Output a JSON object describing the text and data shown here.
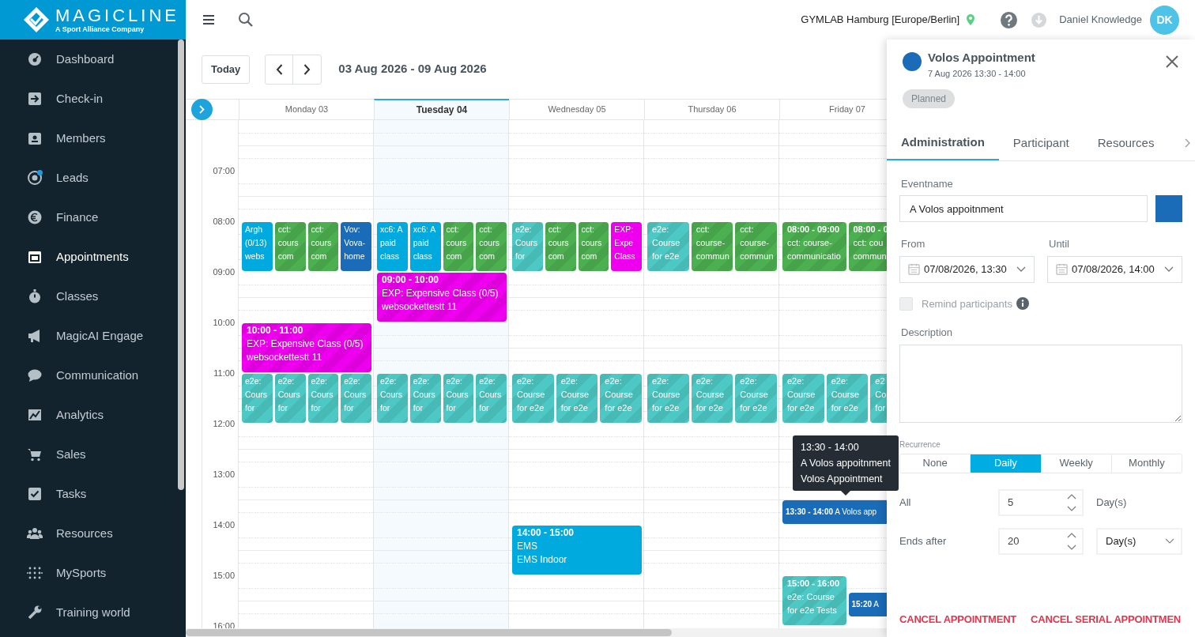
{
  "brand": {
    "name": "MAGICLINE",
    "tagline": "A Sport Alliance Company"
  },
  "sidebar": {
    "items": [
      {
        "label": "Dashboard",
        "selected": false,
        "notification": false
      },
      {
        "label": "Check-in",
        "selected": false,
        "notification": false
      },
      {
        "label": "Members",
        "selected": false,
        "notification": false
      },
      {
        "label": "Leads",
        "selected": false,
        "notification": true
      },
      {
        "label": "Finance",
        "selected": false,
        "notification": false
      },
      {
        "label": "Appointments",
        "selected": true,
        "notification": false
      },
      {
        "label": "Classes",
        "selected": false,
        "notification": false
      },
      {
        "label": "MagicAI Engage",
        "selected": false,
        "notification": false
      },
      {
        "label": "Communication",
        "selected": false,
        "notification": false
      },
      {
        "label": "Analytics",
        "selected": false,
        "notification": false
      },
      {
        "label": "Sales",
        "selected": false,
        "notification": false
      },
      {
        "label": "Tasks",
        "selected": false,
        "notification": false
      },
      {
        "label": "Resources",
        "selected": false,
        "notification": false
      },
      {
        "label": "MySports",
        "selected": false,
        "notification": false
      },
      {
        "label": "Training world",
        "selected": false,
        "notification": false
      }
    ]
  },
  "topbar": {
    "location": "GYMLAB Hamburg [Europe/Berlin]",
    "user": "Daniel Knowledge",
    "initials": "DK"
  },
  "toolbar": {
    "today": "Today",
    "range": "03 Aug 2026 - 09 Aug 2026"
  },
  "calendar": {
    "hours": [
      "07:00",
      "08:00",
      "09:00",
      "10:00",
      "11:00",
      "12:00",
      "13:00",
      "14:00",
      "15:00",
      "16:00"
    ],
    "days": [
      {
        "label": "Monday 03",
        "today": false,
        "events": [
          {
            "kind": "appointment",
            "color": "#00aadf",
            "lines": [
              "Argh",
              "(0/13)",
              "webs"
            ]
          },
          {
            "kind": "class",
            "color": "#4caf50",
            "lines": [
              "cct:",
              "cours",
              "com"
            ]
          },
          {
            "kind": "class",
            "color": "#4caf50",
            "lines": [
              "cct:",
              "cours",
              "com"
            ]
          },
          {
            "kind": "appointment",
            "color": "#1a6bb8",
            "lines": [
              "Vov:",
              "Vova-",
              "home"
            ]
          },
          {
            "kind": "class",
            "color": "#ee00ee",
            "time": "10:00 - 11:00",
            "lines": [
              "EXP: Expensive Class (0/5)",
              "websockettestt 11"
            ]
          },
          {
            "kind": "class",
            "color": "#4dc8c4",
            "lines": [
              "e2e:",
              "Cours",
              "for"
            ]
          },
          {
            "kind": "class",
            "color": "#4dc8c4",
            "lines": [
              "e2e:",
              "Cours",
              "for"
            ]
          },
          {
            "kind": "class",
            "color": "#4dc8c4",
            "lines": [
              "e2e:",
              "Cours",
              "for"
            ]
          },
          {
            "kind": "class",
            "color": "#4dc8c4",
            "lines": [
              "e2e:",
              "Cours",
              "for"
            ]
          }
        ]
      },
      {
        "label": "Tuesday 04",
        "today": true,
        "events": [
          {
            "kind": "appointment",
            "color": "#00aadf",
            "lines": [
              "xc6: A",
              "paid",
              "class"
            ]
          },
          {
            "kind": "appointment",
            "color": "#00aadf",
            "lines": [
              "xc6: A",
              "paid",
              "class"
            ]
          },
          {
            "kind": "class",
            "color": "#4caf50",
            "lines": [
              "cct:",
              "cours",
              "com"
            ]
          },
          {
            "kind": "class",
            "color": "#4caf50",
            "lines": [
              "cct:",
              "cours",
              "com"
            ]
          },
          {
            "kind": "class",
            "color": "#ee00ee",
            "time": "09:00 - 10:00",
            "lines": [
              "EXP: Expensive Class (0/5)",
              "websockettestt 11"
            ]
          },
          {
            "kind": "class",
            "color": "#4dc8c4",
            "lines": [
              "e2e:",
              "Cours",
              "for"
            ]
          },
          {
            "kind": "class",
            "color": "#4dc8c4",
            "lines": [
              "e2e:",
              "Cours",
              "for"
            ]
          },
          {
            "kind": "class",
            "color": "#4dc8c4",
            "lines": [
              "e2e:",
              "Cours",
              "for"
            ]
          },
          {
            "kind": "class",
            "color": "#4dc8c4",
            "lines": [
              "e2e:",
              "Cours",
              "for"
            ]
          }
        ]
      },
      {
        "label": "Wednesday 05",
        "today": false,
        "events": [
          {
            "kind": "class",
            "color": "#4dc8c4",
            "lines": [
              "e2e:",
              "Cours",
              "for"
            ]
          },
          {
            "kind": "class",
            "color": "#4caf50",
            "lines": [
              "cct:",
              "cours",
              "com"
            ]
          },
          {
            "kind": "class",
            "color": "#4caf50",
            "lines": [
              "cct:",
              "cours",
              "com"
            ]
          },
          {
            "kind": "appointment",
            "color": "#ee00ee",
            "lines": [
              "EXP:",
              "Expe",
              "Class"
            ]
          },
          {
            "kind": "class",
            "color": "#4dc8c4",
            "lines": [
              "e2e:",
              "Course",
              "for e2e"
            ]
          },
          {
            "kind": "class",
            "color": "#4dc8c4",
            "lines": [
              "e2e:",
              "Course",
              "for e2e"
            ]
          },
          {
            "kind": "class",
            "color": "#4dc8c4",
            "lines": [
              "e2e:",
              "Course",
              "for e2e"
            ]
          },
          {
            "kind": "appointment",
            "color": "#00aadf",
            "time": "14:00 - 15:00",
            "lines": [
              "EMS",
              "EMS Indoor"
            ]
          }
        ]
      },
      {
        "label": "Thursday 06",
        "today": false,
        "events": [
          {
            "kind": "class",
            "color": "#4dc8c4",
            "lines": [
              "e2e:",
              "Course",
              "for e2e"
            ]
          },
          {
            "kind": "class",
            "color": "#4caf50",
            "lines": [
              "cct:",
              "course-",
              "commun"
            ]
          },
          {
            "kind": "class",
            "color": "#4caf50",
            "lines": [
              "cct:",
              "course-",
              "commun"
            ]
          },
          {
            "kind": "class",
            "color": "#4dc8c4",
            "lines": [
              "e2e:",
              "Course",
              "for e2e"
            ]
          },
          {
            "kind": "class",
            "color": "#4dc8c4",
            "lines": [
              "e2e:",
              "Course",
              "for e2e"
            ]
          },
          {
            "kind": "class",
            "color": "#4dc8c4",
            "lines": [
              "e2e:",
              "Course",
              "for e2e"
            ]
          }
        ]
      },
      {
        "label": "Friday 07",
        "today": false,
        "events": [
          {
            "kind": "class",
            "color": "#4caf50",
            "time": "08:00 - 09:00",
            "lines": [
              "cct: course-",
              "communicatio"
            ]
          },
          {
            "kind": "class",
            "color": "#4caf50",
            "time": "08:00 - 0",
            "lines": [
              "cct: cou",
              "commun"
            ]
          },
          {
            "kind": "class",
            "color": "#4dc8c4",
            "lines": [
              "e2e:",
              "Course",
              "for e2e"
            ]
          },
          {
            "kind": "class",
            "color": "#4dc8c4",
            "lines": [
              "e2e:",
              "Course",
              "for e2e"
            ]
          },
          {
            "kind": "class",
            "color": "#4dc8c4",
            "lines": [
              "e2",
              "Co",
              "for"
            ]
          },
          {
            "kind": "appointment",
            "color": "#1a6bb8",
            "time": "13:30 - 14:00",
            "lines": [
              "A Volos app"
            ]
          },
          {
            "kind": "class",
            "color": "#4dc8c4",
            "time": "15:00 - 16:00",
            "lines": [
              "e2e: Course",
              "for e2e Tests"
            ]
          },
          {
            "kind": "appointment",
            "color": "#1a6bb8",
            "time": "15:20",
            "lines": [
              "A"
            ]
          }
        ]
      }
    ]
  },
  "tooltip": {
    "lines": [
      "13:30 - 14:00",
      "A Volos appoitnment",
      "Volos Appointment"
    ]
  },
  "panel": {
    "color": "#1a6bb8",
    "title": "Volos Appointment",
    "subtitle": "7 Aug 2026 13:30 - 14:00",
    "status": "Planned",
    "tabs": [
      {
        "label": "Administration",
        "selected": true
      },
      {
        "label": "Participant",
        "selected": false
      },
      {
        "label": "Resources",
        "selected": false
      }
    ],
    "eventname": {
      "label": "Eventname",
      "value": "A Volos appoitnment",
      "color": "#1a6bb8"
    },
    "from": {
      "label": "From",
      "value": "07/08/2026, 13:30"
    },
    "until": {
      "label": "Until",
      "value": "07/08/2026, 14:00"
    },
    "remind": {
      "label": "Remind participants",
      "checked": false,
      "disabled": true
    },
    "description": {
      "label": "Description"
    },
    "recurrence": {
      "label": "Recurrence",
      "options": [
        {
          "label": "None",
          "selected": false
        },
        {
          "label": "Daily",
          "selected": true
        },
        {
          "label": "Weekly",
          "selected": false
        },
        {
          "label": "Monthly",
          "selected": false
        }
      ]
    },
    "interval": {
      "label": "All",
      "value": "5",
      "unit": "Day(s)"
    },
    "ends_after": {
      "label": "Ends after",
      "value": "20",
      "unit": "Day(s)"
    },
    "actions": [
      "CANCEL APPOINTMENT",
      "CANCEL SERIAL APPOINTMEN"
    ]
  }
}
